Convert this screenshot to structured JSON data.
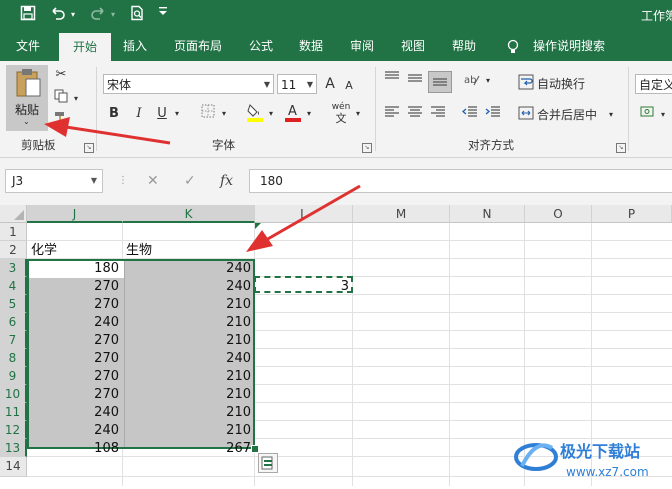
{
  "window": {
    "title": "工作簿"
  },
  "qat": {
    "save_icon": "save-icon",
    "undo_icon": "undo-icon",
    "redo_icon": "redo-icon",
    "print_preview_icon": "print-preview-icon",
    "customize_icon": "customize-qat-icon"
  },
  "tabs": [
    "文件",
    "开始",
    "插入",
    "页面布局",
    "公式",
    "数据",
    "审阅",
    "视图",
    "帮助",
    "操作说明搜索"
  ],
  "active_tab": "开始",
  "ribbon": {
    "clipboard": {
      "paste_label": "粘贴",
      "group_label": "剪贴板"
    },
    "font": {
      "font_name": "宋体",
      "font_size": "11",
      "group_label": "字体",
      "bold": "B",
      "italic": "I",
      "underline": "U",
      "grow": "A",
      "shrink": "A",
      "phonetic": "wén"
    },
    "alignment": {
      "wrap_text": "自动换行",
      "merge_center": "合并后居中",
      "group_label": "对齐方式"
    },
    "number": {
      "format": "自定义"
    }
  },
  "formula_bar": {
    "name_box": "J3",
    "fx": "fx",
    "value": "180"
  },
  "columns": [
    "J",
    "K",
    "L",
    "M",
    "N",
    "O",
    "P"
  ],
  "rows": [
    "1",
    "2",
    "3",
    "4",
    "5",
    "6",
    "7",
    "8",
    "9",
    "10",
    "11",
    "12",
    "13",
    "14"
  ],
  "cells": {
    "J2": "化学",
    "K2": "生物",
    "J_values": [
      "180",
      "270",
      "270",
      "240",
      "270",
      "270",
      "270",
      "270",
      "240",
      "240",
      "108"
    ],
    "K_values": [
      "240",
      "240",
      "210",
      "210",
      "210",
      "240",
      "210",
      "210",
      "210",
      "210",
      "267"
    ],
    "L4": "3"
  },
  "colors": {
    "accent": "#217346",
    "arrow": "#e03131"
  }
}
